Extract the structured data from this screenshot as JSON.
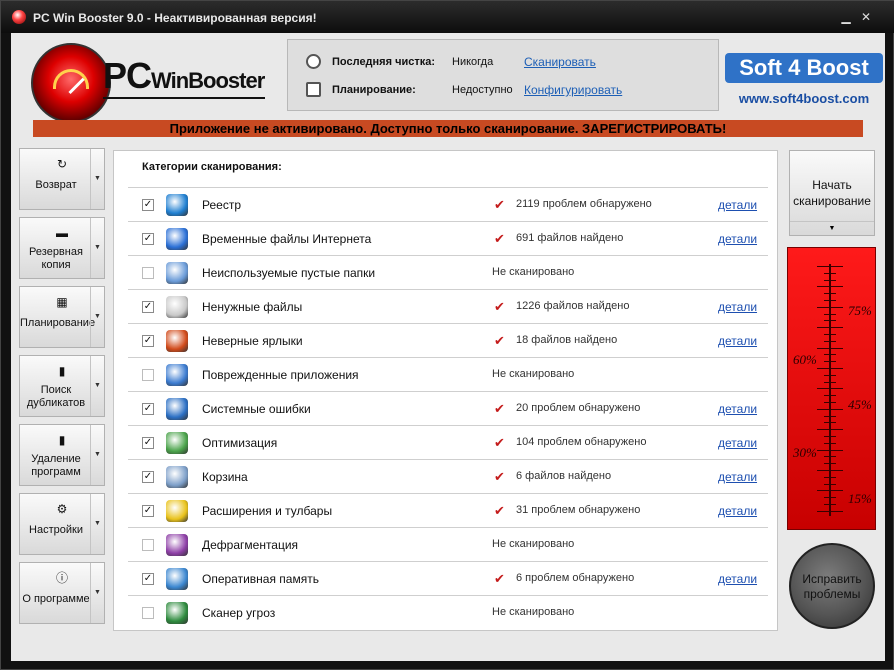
{
  "window": {
    "title": "PC Win Booster 9.0 - Неактивированная версия!"
  },
  "logo": {
    "text_pc": "PC",
    "text_wb": "WinBooster"
  },
  "info": {
    "last_clean_label": "Последняя чистка:",
    "last_clean_value": "Никогда",
    "last_clean_link": "Сканировать",
    "schedule_label": "Планирование:",
    "schedule_value": "Недоступно",
    "schedule_link": "Конфигурировать"
  },
  "brand": {
    "name": "Soft 4 Boost",
    "url": "www.soft4boost.com"
  },
  "banner": {
    "text": "Приложение не активировано. Доступно только сканирование. ЗАРЕГИСТРИРОВАТЬ!"
  },
  "sidebar": {
    "items": [
      {
        "label": "Возврат",
        "icon": "restore-icon"
      },
      {
        "label": "Резервная копия",
        "icon": "backup-icon"
      },
      {
        "label": "Планирование",
        "icon": "schedule-icon"
      },
      {
        "label": "Поиск дубликатов",
        "icon": "duplicates-icon"
      },
      {
        "label": "Удаление программ",
        "icon": "uninstall-icon"
      },
      {
        "label": "Настройки",
        "icon": "settings-icon"
      },
      {
        "label": "О программе",
        "icon": "about-icon"
      }
    ]
  },
  "panel": {
    "header": "Категории сканирования:",
    "details_label": "детали",
    "rows": [
      {
        "name": "Реестр",
        "checked": true,
        "scanned": true,
        "status": "2119 проблем обнаружено",
        "color": "#1f7fd1"
      },
      {
        "name": "Временные файлы Интернета",
        "checked": true,
        "scanned": true,
        "status": "691 файлов найдено",
        "color": "#2a6fd6"
      },
      {
        "name": "Неиспользуемые пустые папки",
        "checked": false,
        "scanned": false,
        "status": "Не сканировано",
        "color": "#6a9bd8"
      },
      {
        "name": "Ненужные файлы",
        "checked": true,
        "scanned": true,
        "status": "1226 файлов найдено",
        "color": "#c9c9c9"
      },
      {
        "name": "Неверные ярлыки",
        "checked": true,
        "scanned": true,
        "status": "18 файлов найдено",
        "color": "#d14a1a"
      },
      {
        "name": "Поврежденные приложения",
        "checked": false,
        "scanned": false,
        "status": "Не сканировано",
        "color": "#3b7bd0"
      },
      {
        "name": "Системные ошибки",
        "checked": true,
        "scanned": true,
        "status": "20 проблем обнаружено",
        "color": "#2b6fc4"
      },
      {
        "name": "Оптимизация",
        "checked": true,
        "scanned": true,
        "status": "104 проблем обнаружено",
        "color": "#4aa34a"
      },
      {
        "name": "Корзина",
        "checked": true,
        "scanned": true,
        "status": "6 файлов найдено",
        "color": "#7d9fc9"
      },
      {
        "name": "Расширения и тулбары",
        "checked": true,
        "scanned": true,
        "status": "31 проблем обнаружено",
        "color": "#e9c21a"
      },
      {
        "name": "Дефрагментация",
        "checked": false,
        "scanned": false,
        "status": "Не сканировано",
        "color": "#8e3fa7"
      },
      {
        "name": "Оперативная память",
        "checked": true,
        "scanned": true,
        "status": "6 проблем обнаружено",
        "color": "#3a86d0"
      },
      {
        "name": "Сканер угроз",
        "checked": false,
        "scanned": false,
        "status": "Не сканировано",
        "color": "#2e8b3e"
      }
    ]
  },
  "scan_button": {
    "label": "Начать сканирование"
  },
  "meter": {
    "labels": [
      "75%",
      "60%",
      "45%",
      "30%",
      "15%"
    ]
  },
  "fix_button": {
    "label": "Исправить проблемы"
  },
  "colors": {
    "accent": "#c84a22",
    "meter_red": "#ff1a1a",
    "link": "#1d4fb0",
    "brand": "#2f72c7"
  }
}
